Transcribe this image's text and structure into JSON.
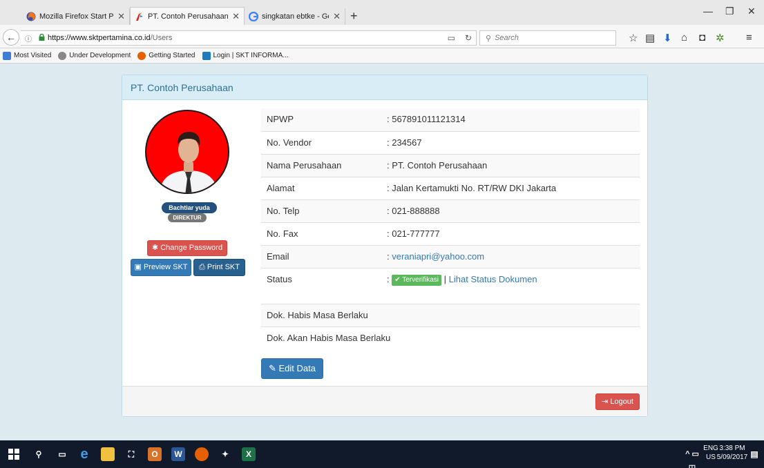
{
  "browser": {
    "tabs": [
      {
        "title": "Mozilla Firefox Start Page",
        "icon": "firefox-icon",
        "active": false
      },
      {
        "title": "PT. Contoh Perusahaan | SKT",
        "icon": "pertamina-icon",
        "active": true
      },
      {
        "title": "singkatan ebtke - Google Se",
        "icon": "google-icon",
        "active": false
      }
    ],
    "url_host": "https://www.sktpertamina.co.id",
    "url_path": "/Users",
    "search_placeholder": "Search",
    "bookmarks": [
      {
        "label": "Most Visited",
        "icon": "most-visited-icon",
        "color": "#3d7fd6"
      },
      {
        "label": "Under Development",
        "icon": "globe-icon",
        "color": "#888888"
      },
      {
        "label": "Getting Started",
        "icon": "firefox-icon",
        "color": "#e66000"
      },
      {
        "label": "Login | SKT INFORMA...",
        "icon": "pertamina-icon",
        "color": "#1d7bbf"
      }
    ]
  },
  "panel": {
    "title": "PT. Contoh Perusahaan"
  },
  "profile": {
    "name": "Bachtiar yuda",
    "role": "DIREKTUR",
    "change_password": "Change Password",
    "preview_skt": "Preview SKT",
    "print_skt": "Print SKT"
  },
  "info": {
    "npwp_label": "NPWP",
    "npwp_value": ": 567891011121314",
    "vendor_label": "No. Vendor",
    "vendor_value": ": 234567",
    "company_label": "Nama Perusahaan",
    "company_value": ": PT. Contoh Perusahaan",
    "address_label": "Alamat",
    "address_value": ": Jalan Kertamukti No. RT/RW DKI Jakarta",
    "phone_label": "No. Telp",
    "phone_value": ": 021-888888",
    "fax_label": "No. Fax",
    "fax_value": ": 021-777777",
    "email_label": "Email",
    "email_prefix": ": ",
    "email_value": "veraniapri@yahoo.com",
    "status_label": "Status",
    "status_prefix": ": ",
    "status_badge": "Terverifikasi",
    "status_sep": " | ",
    "status_link": "Lihat Status Dokumen",
    "expired_label": "Dok. Habis Masa Berlaku",
    "expiring_label": "Dok. Akan Habis Masa Berlaku"
  },
  "actions": {
    "edit_data": "Edit Data",
    "logout": "Logout"
  },
  "taskbar": {
    "lang": "ENG",
    "locale": "US",
    "time": "3:38 PM",
    "date": "5/09/2017"
  }
}
